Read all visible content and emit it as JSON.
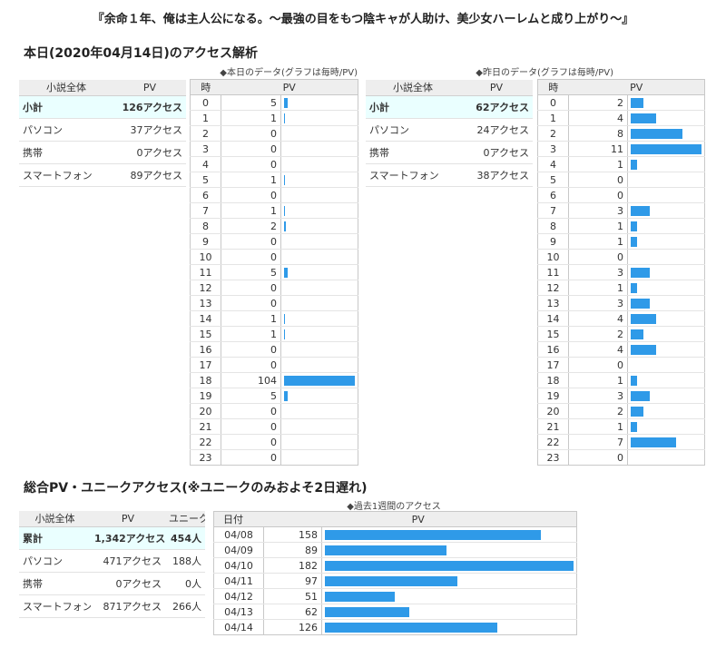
{
  "title": "『余命１年、俺は主人公になる。～最強の目をもつ陰キャが人助け、美少女ハーレムと成り上がり～』",
  "colors": {
    "bar": "#2f9ae8",
    "highlight_row": "#eaffff",
    "header_bg": "#eeeeee"
  },
  "today": {
    "heading": "本日(2020年04月14日)のアクセス解析",
    "caption": "◆本日のデータ(グラフは毎時/PV)",
    "summary_headers": [
      "小説全体",
      "PV"
    ],
    "summary_rows": [
      {
        "label": "小計",
        "value": "126アクセス"
      },
      {
        "label": "パソコン",
        "value": "37アクセス"
      },
      {
        "label": "携帯",
        "value": "0アクセス"
      },
      {
        "label": "スマートフォン",
        "value": "89アクセス"
      }
    ],
    "hourly_headers": [
      "時",
      "PV"
    ],
    "hourly": [
      {
        "hour": "0",
        "pv": 5
      },
      {
        "hour": "1",
        "pv": 1
      },
      {
        "hour": "2",
        "pv": 0
      },
      {
        "hour": "3",
        "pv": 0
      },
      {
        "hour": "4",
        "pv": 0
      },
      {
        "hour": "5",
        "pv": 1
      },
      {
        "hour": "6",
        "pv": 0
      },
      {
        "hour": "7",
        "pv": 1
      },
      {
        "hour": "8",
        "pv": 2
      },
      {
        "hour": "9",
        "pv": 0
      },
      {
        "hour": "10",
        "pv": 0
      },
      {
        "hour": "11",
        "pv": 5
      },
      {
        "hour": "12",
        "pv": 0
      },
      {
        "hour": "13",
        "pv": 0
      },
      {
        "hour": "14",
        "pv": 1
      },
      {
        "hour": "15",
        "pv": 1
      },
      {
        "hour": "16",
        "pv": 0
      },
      {
        "hour": "17",
        "pv": 0
      },
      {
        "hour": "18",
        "pv": 104
      },
      {
        "hour": "19",
        "pv": 5
      },
      {
        "hour": "20",
        "pv": 0
      },
      {
        "hour": "21",
        "pv": 0
      },
      {
        "hour": "22",
        "pv": 0
      },
      {
        "hour": "23",
        "pv": 0
      }
    ]
  },
  "yesterday": {
    "caption": "◆昨日のデータ(グラフは毎時/PV)",
    "summary_headers": [
      "小説全体",
      "PV"
    ],
    "summary_rows": [
      {
        "label": "小計",
        "value": "62アクセス"
      },
      {
        "label": "パソコン",
        "value": "24アクセス"
      },
      {
        "label": "携帯",
        "value": "0アクセス"
      },
      {
        "label": "スマートフォン",
        "value": "38アクセス"
      }
    ],
    "hourly_headers": [
      "時",
      "PV"
    ],
    "hourly": [
      {
        "hour": "0",
        "pv": 2
      },
      {
        "hour": "1",
        "pv": 4
      },
      {
        "hour": "2",
        "pv": 8
      },
      {
        "hour": "3",
        "pv": 11
      },
      {
        "hour": "4",
        "pv": 1
      },
      {
        "hour": "5",
        "pv": 0
      },
      {
        "hour": "6",
        "pv": 0
      },
      {
        "hour": "7",
        "pv": 3
      },
      {
        "hour": "8",
        "pv": 1
      },
      {
        "hour": "9",
        "pv": 1
      },
      {
        "hour": "10",
        "pv": 0
      },
      {
        "hour": "11",
        "pv": 3
      },
      {
        "hour": "12",
        "pv": 1
      },
      {
        "hour": "13",
        "pv": 3
      },
      {
        "hour": "14",
        "pv": 4
      },
      {
        "hour": "15",
        "pv": 2
      },
      {
        "hour": "16",
        "pv": 4
      },
      {
        "hour": "17",
        "pv": 0
      },
      {
        "hour": "18",
        "pv": 1
      },
      {
        "hour": "19",
        "pv": 3
      },
      {
        "hour": "20",
        "pv": 2
      },
      {
        "hour": "21",
        "pv": 1
      },
      {
        "hour": "22",
        "pv": 7
      },
      {
        "hour": "23",
        "pv": 0
      }
    ]
  },
  "total": {
    "heading": "総合PV・ユニークアクセス(※ユニークのみおよそ2日遅れ)",
    "summary_headers": [
      "小説全体",
      "PV",
      "ユニーク"
    ],
    "summary_rows": [
      {
        "label": "累計",
        "pv": "1,342アクセス",
        "unique": "454人"
      },
      {
        "label": "パソコン",
        "pv": "471アクセス",
        "unique": "188人"
      },
      {
        "label": "携帯",
        "pv": "0アクセス",
        "unique": "0人"
      },
      {
        "label": "スマートフォン",
        "pv": "871アクセス",
        "unique": "266人"
      }
    ],
    "weekly_caption": "◆過去1週間のアクセス",
    "weekly_headers": [
      "日付",
      "PV"
    ],
    "weekly": [
      {
        "date": "04/08",
        "pv": 158
      },
      {
        "date": "04/09",
        "pv": 89
      },
      {
        "date": "04/10",
        "pv": 182
      },
      {
        "date": "04/11",
        "pv": 97
      },
      {
        "date": "04/12",
        "pv": 51
      },
      {
        "date": "04/13",
        "pv": 62
      },
      {
        "date": "04/14",
        "pv": 126
      }
    ]
  }
}
